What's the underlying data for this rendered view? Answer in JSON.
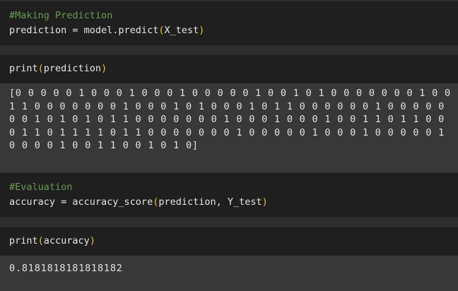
{
  "cells": [
    {
      "comment": "#Making Prediction",
      "code": {
        "before": "prediction = model.predict",
        "open": "(",
        "args": "X_test",
        "close": ")"
      }
    },
    {
      "code": {
        "before": "print",
        "open": "(",
        "args": "prediction",
        "close": ")"
      },
      "output": "[0 0 0 0 0 1 0 0 0 1 0 0 0 1 0 0 0 0 0 1 0 0 1 0 1 0 0 0 0 0 0 0 1 0 0 1 1 0 0 0 0 0 0 0 1 0 0 0 1 0 1 0 0 0 1 0 1 1 0 0 0 0 0 0 1 0 0 0 0 0 0 0 1 0 1 0 1 0 1 1 0 0 0 0 0 0 0 1 0 0 0 1 0 0 0 1 0 0 1 1 0 1 1 0 0 0 1 1 0 1 1 1 1 0 1 1 0 0 0 0 0 0 0 1 0 0 0 0 0 1 0 0 0 1 0 0 0 0 0 1 0 0 0 0 1 0 0 1 1 0 0 1 0 1 0]"
    },
    {
      "comment": "#Evaluation",
      "code": {
        "before": "accuracy = accuracy_score",
        "open": "(",
        "args": "prediction, Y_test",
        "close": ")"
      }
    },
    {
      "code": {
        "before": "print",
        "open": "(",
        "args": "accuracy",
        "close": ")"
      },
      "output": "0.8181818181818182"
    }
  ],
  "colors": {
    "background": "#2d2d2d",
    "code_cell": "#1f1f1f",
    "output_area": "#383838",
    "comment": "#6a9955",
    "paren": "#e8c33c",
    "text": "#e6e6e6"
  }
}
